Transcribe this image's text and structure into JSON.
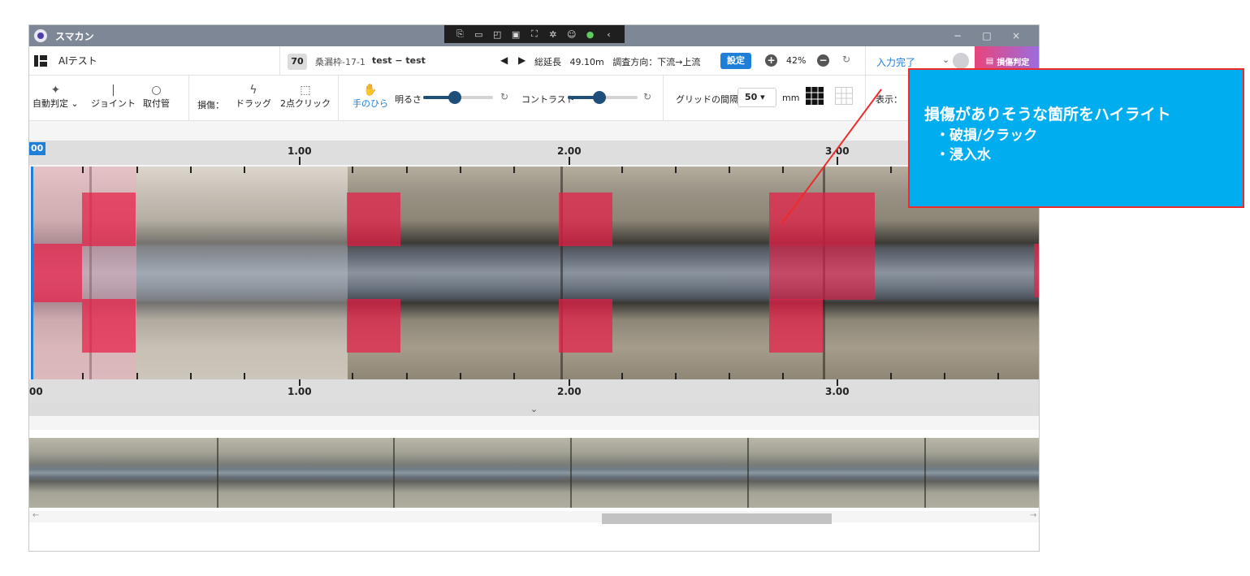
{
  "window": {
    "title": "スマカン",
    "controls": {
      "minimize": "−",
      "maximize": "□",
      "close": "×"
    }
  },
  "capture_toolbar": {
    "icons": [
      "screenshot-icon",
      "record-icon",
      "window-icon",
      "region-icon",
      "fullscreen-icon",
      "settings-icon",
      "accessibility-icon",
      "check-icon",
      "chevron-left-icon"
    ]
  },
  "header": {
    "project_name": "AIテスト",
    "frame_number": "70",
    "frame_id": "桑漏枠-17-1",
    "record_name": "test − test",
    "total_length_label": "総延長",
    "total_length_value": "49.10m",
    "direction_label": "調査方向：下流→上流",
    "settings_button": "設定",
    "zoom_value": "42%",
    "input_done": "入力完了",
    "damage_judgement": "損傷判定"
  },
  "toolbar": {
    "auto_judge": "自動判定",
    "joint": "ジョイント",
    "fitting": "取付管",
    "damage_label": "損傷：",
    "drag": "ドラッグ",
    "two_point_click": "2点クリック",
    "hand": "手のひら",
    "brightness": "明るさ",
    "brightness_value": 0.45,
    "contrast": "コントラスト",
    "contrast_value": 0.45,
    "grid_spacing_label": "グリッドの間隔",
    "grid_spacing_value": "50",
    "grid_unit": "mm",
    "display_label": "表示："
  },
  "ruler": {
    "origin": "00",
    "labels": [
      "1.00",
      "2.00",
      "3.00"
    ],
    "bottom_origin": "00"
  },
  "callout": {
    "title": "損傷がありそうな箇所をハイライト",
    "items": [
      "・破損/クラック",
      "・浸入水"
    ]
  },
  "colors": {
    "accent": "#1e7fd8",
    "highlight": "#e81e46",
    "callout_bg": "#00adef",
    "callout_border": "#ee2a2a",
    "titlebar": "#7d8795"
  }
}
